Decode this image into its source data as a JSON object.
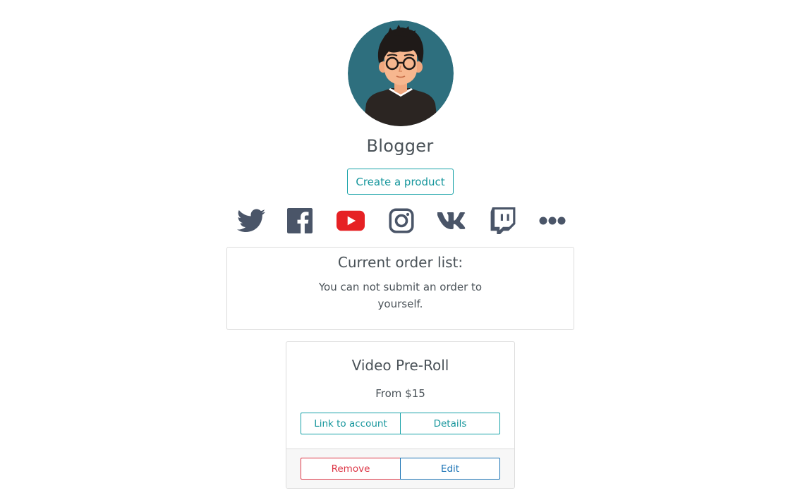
{
  "profile": {
    "name": "Blogger",
    "create_button": "Create a product"
  },
  "socials": [
    {
      "icon": "twitter-icon",
      "color": "#4a5568"
    },
    {
      "icon": "facebook-icon",
      "color": "#4a5568"
    },
    {
      "icon": "youtube-icon",
      "color": "#e62124"
    },
    {
      "icon": "instagram-icon",
      "color": "#4a5568"
    },
    {
      "icon": "vk-icon",
      "color": "#4a5568"
    },
    {
      "icon": "twitch-icon",
      "color": "#4a5568"
    },
    {
      "icon": "more-icon",
      "color": "#4a5568"
    }
  ],
  "orders": {
    "title": "Current order list:",
    "message": "You can not submit an order to yourself."
  },
  "product": {
    "title": "Video Pre-Roll",
    "price": "From $15",
    "link_button": "Link to account",
    "details_button": "Details",
    "remove_button": "Remove",
    "edit_button": "Edit"
  },
  "colors": {
    "accent": "#17a2a8",
    "danger": "#dc3545",
    "primary": "#1a73b5",
    "avatar_bg": "#2e6f7e"
  }
}
